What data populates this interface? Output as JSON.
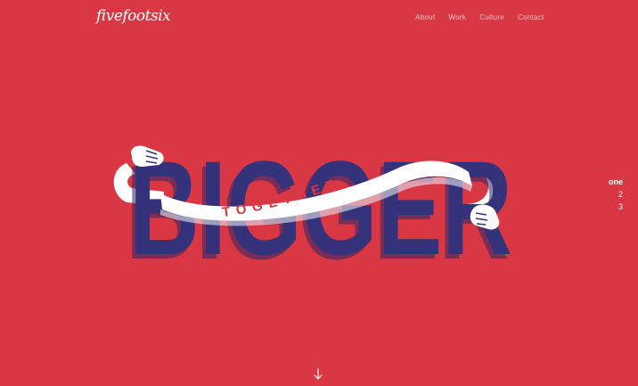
{
  "header": {
    "logo_text": "fivefootsix",
    "nav": [
      {
        "label": "About"
      },
      {
        "label": "Work"
      },
      {
        "label": "Culture"
      },
      {
        "label": "Contact"
      }
    ]
  },
  "hero": {
    "headline": "BIGGER",
    "banner_text": "TOGETHER",
    "colors": {
      "background": "#d93744",
      "letters": "#34327a",
      "banner": "#ffffff",
      "banner_text": "#d93744"
    }
  },
  "slide_nav": {
    "items": [
      {
        "label": "one",
        "active": true
      },
      {
        "label": "2",
        "active": false
      },
      {
        "label": "3",
        "active": false
      }
    ]
  },
  "scroll": {
    "icon": "arrow-down-icon"
  }
}
